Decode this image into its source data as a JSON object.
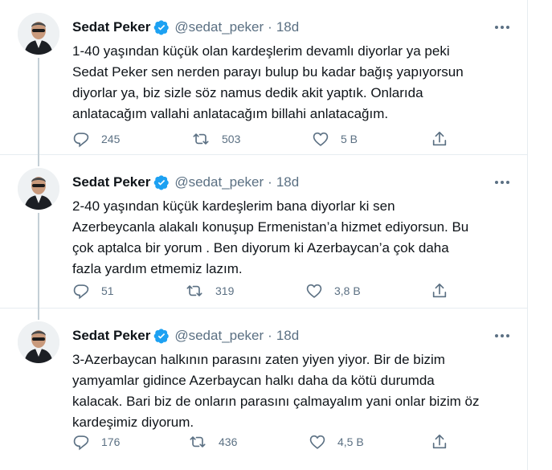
{
  "colors": {
    "verified": "#1da1f2",
    "text": "#0f1419",
    "secondary": "#5b7083",
    "border": "#e6ecf0",
    "thread_line": "#c4cfd6"
  },
  "tweets": [
    {
      "name": "Sedat Peker",
      "handle": "@sedat_peker",
      "dot": "·",
      "time": "18d",
      "text": "1-40 yaşından küçük olan kardeşlerim devamlı diyorlar ya peki\nSedat Peker sen nerden parayı bulup bu kadar bağış yapıyorsun\ndiyorlar ya, biz sizle söz namus dedik akit yaptık. Onlarıda\nanlatacağım vallahi anlatacağım billahi anlatacağım.",
      "replies": "245",
      "retweets": "503",
      "likes": "5 B",
      "icons": {
        "reply": "reply-icon",
        "retweet": "retweet-icon",
        "like": "heart-icon",
        "share": "share-icon",
        "more": "more-icon",
        "verified": "verified-badge-icon"
      }
    },
    {
      "name": "Sedat Peker",
      "handle": "@sedat_peker",
      "dot": "·",
      "time": "18d",
      "text": "2-40 yaşından küçük kardeşlerim bana diyorlar ki sen\nAzerbeycanla alakalı konuşup Ermenistan’a hizmet ediyorsun. Bu\nçok aptalca bir yorum . Ben diyorum ki Azerbaycan’a çok daha\nfazla yardım etmemiz lazım.",
      "replies": "51",
      "retweets": "319",
      "likes": "3,8 B",
      "icons": {
        "reply": "reply-icon",
        "retweet": "retweet-icon",
        "like": "heart-icon",
        "share": "share-icon",
        "more": "more-icon",
        "verified": "verified-badge-icon"
      }
    },
    {
      "name": "Sedat Peker",
      "handle": "@sedat_peker",
      "dot": "·",
      "time": "18d",
      "text": "3-Azerbaycan halkının parasını zaten yiyen yiyor. Bir de bizim\nyamyamlar gidince Azerbaycan halkı daha da kötü durumda\nkalacak. Bari biz de onların parasını çalmayalım yani onlar bizim öz\nkardeşimiz diyorum.",
      "replies": "176",
      "retweets": "436",
      "likes": "4,5 B",
      "icons": {
        "reply": "reply-icon",
        "retweet": "retweet-icon",
        "like": "heart-icon",
        "share": "share-icon",
        "more": "more-icon",
        "verified": "verified-badge-icon"
      }
    }
  ]
}
